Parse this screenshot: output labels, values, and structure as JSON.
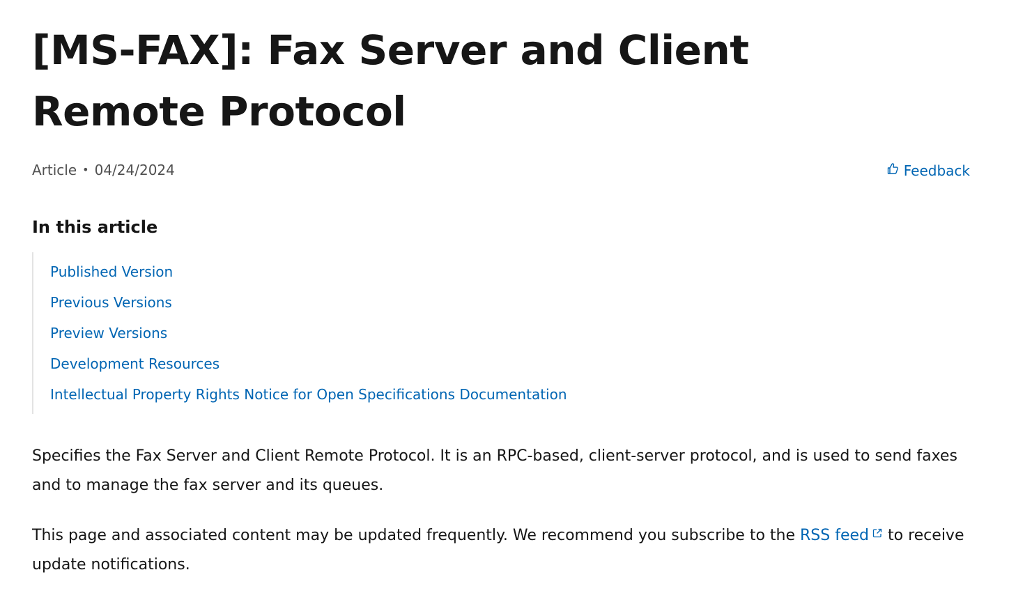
{
  "article": {
    "title": "[MS-FAX]: Fax Server and Client Remote Protocol",
    "type_label": "Article",
    "date": "04/24/2024",
    "feedback_label": "Feedback"
  },
  "toc": {
    "heading": "In this article",
    "items": [
      {
        "label": "Published Version"
      },
      {
        "label": "Previous Versions"
      },
      {
        "label": "Preview Versions"
      },
      {
        "label": "Development Resources"
      },
      {
        "label": "Intellectual Property Rights Notice for Open Specifications Documentation"
      }
    ]
  },
  "content": {
    "paragraph1": "Specifies the Fax Server and Client Remote Protocol. It is an RPC-based, client-server protocol, and is used to send faxes and to manage the fax server and its queues.",
    "paragraph2_before": "This page and associated content may be updated frequently. We recommend you subscribe to the ",
    "rss_link_label": "RSS feed",
    "paragraph2_after": " to receive update notifications."
  },
  "icons": {
    "feedback": "thumbs-up-icon",
    "external_link": "external-link-icon"
  },
  "colors": {
    "link": "#0065b3",
    "text": "#161616",
    "muted": "#505050"
  }
}
